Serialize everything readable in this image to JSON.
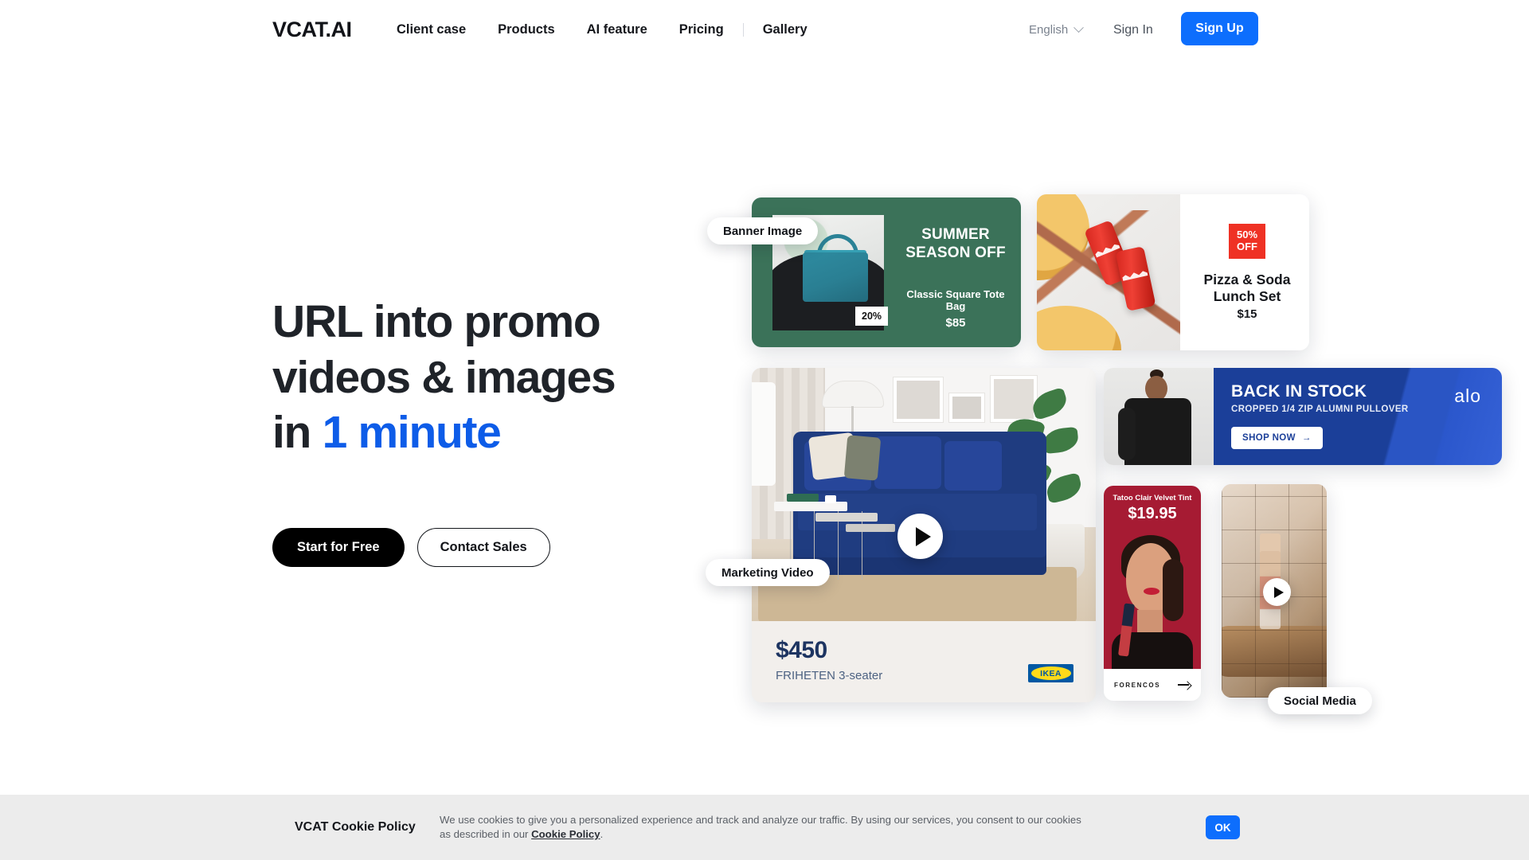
{
  "header": {
    "logo": "VCAT.AI",
    "nav": [
      {
        "label": "Client case"
      },
      {
        "label": "Products"
      },
      {
        "label": "AI feature"
      },
      {
        "label": "Pricing"
      },
      {
        "label": "Gallery"
      }
    ],
    "language": "English",
    "language_icon": "chevron-down-icon",
    "sign_in": "Sign In",
    "sign_up": "Sign Up",
    "accent_color": "#0d6efd"
  },
  "hero": {
    "headline_line1": "URL into promo",
    "headline_line2": "videos & images",
    "headline_line3_prefix": "in ",
    "headline_accent": "1 minute",
    "accent_color": "#0d5ce8",
    "primary_cta": "Start for Free",
    "secondary_cta": "Contact Sales"
  },
  "labels": {
    "banner_image": "Banner Image",
    "marketing_video": "Marketing Video",
    "social_media": "Social Media"
  },
  "cards": {
    "tote": {
      "title_line1": "SUMMER",
      "title_line2": "SEASON OFF",
      "product": "Classic Square Tote Bag",
      "price": "$85",
      "discount": "20%",
      "bg_color": "#3b7259"
    },
    "pizza": {
      "badge_line1": "50%",
      "badge_line2": "OFF",
      "badge_color": "#ef3124",
      "title_line1": "Pizza & Soda",
      "title_line2": "Lunch Set",
      "price": "$15"
    },
    "ikea": {
      "price": "$450",
      "product": "FRIHETEN 3-seater",
      "brand": "IKEA",
      "play_icon": "play-icon"
    },
    "alo": {
      "headline": "BACK IN STOCK",
      "subhead": "CROPPED 1/4 ZIP ALUMNI PULLOVER",
      "cta": "SHOP NOW",
      "cta_icon": "arrow-right-icon",
      "brand": "alo",
      "bg_color": "#1b3f99"
    },
    "cosmetics": {
      "product": "Tatoo Clair Velvet Tint",
      "price": "$19.95",
      "brand": "FORENCOS",
      "arrow_icon": "arrow-right-icon",
      "bg_color": "#a61b33"
    },
    "social": {
      "play_icon": "play-icon"
    }
  },
  "cookie": {
    "title": "VCAT Cookie Policy",
    "text_before": "We use cookies to give you a personalized experience and track and analyze our traffic. By using our services, you consent to our cookies as described in our ",
    "link": "Cookie Policy",
    "text_after": ".",
    "ok": "OK"
  }
}
